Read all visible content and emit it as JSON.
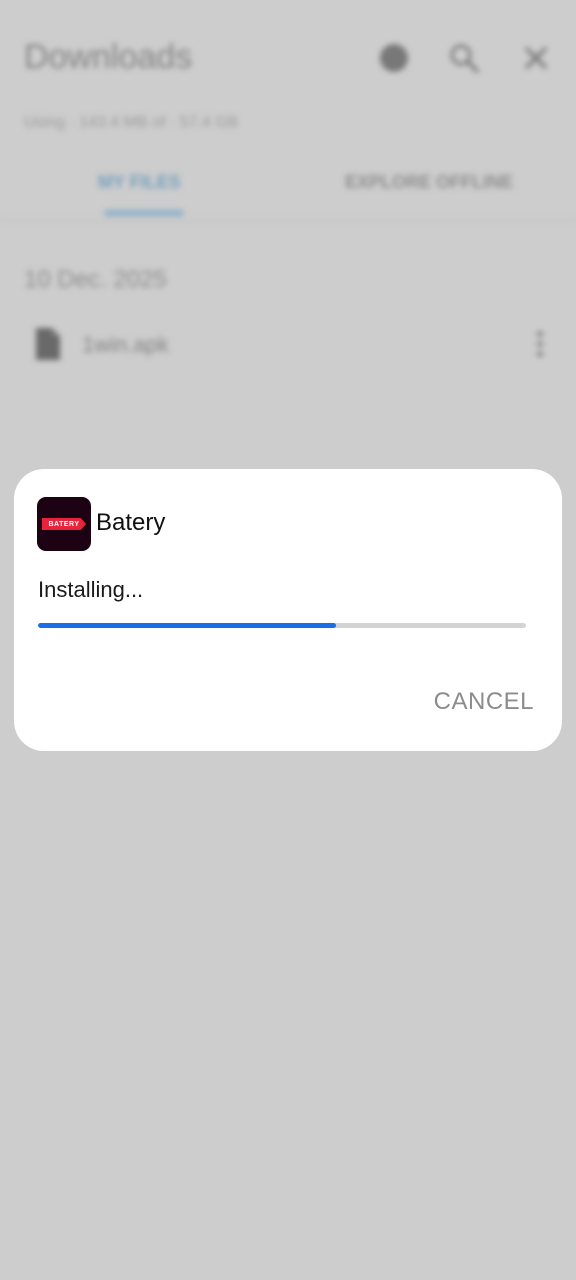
{
  "background_app": {
    "title": "Downloads",
    "usage_text": "Using · 143.4 MB of · 57.4 GB",
    "tabs": [
      {
        "label": "MY FILES",
        "active": true
      },
      {
        "label": "EXPLORE OFFLINE",
        "active": false
      }
    ],
    "icons": [
      "help-icon",
      "search-icon",
      "close-icon"
    ],
    "date_header": "10 Dec. 2025",
    "files": [
      {
        "name": "1win.apk",
        "icon": "file-icon",
        "menu_icon": "more-vert-icon"
      }
    ]
  },
  "dialog": {
    "app_name": "Batery",
    "app_icon_text": "BATERY",
    "status": "Installing...",
    "progress": 0.61,
    "cancel_label": "CANCEL"
  },
  "colors": {
    "progress_fill": "#1a6fe6",
    "progress_track": "#d3d3d3",
    "app_icon_bg": "#1c0212",
    "app_icon_badge": "#e8243d",
    "cancel_text": "#8c8c8c",
    "scrim": "#cfcfcf"
  }
}
